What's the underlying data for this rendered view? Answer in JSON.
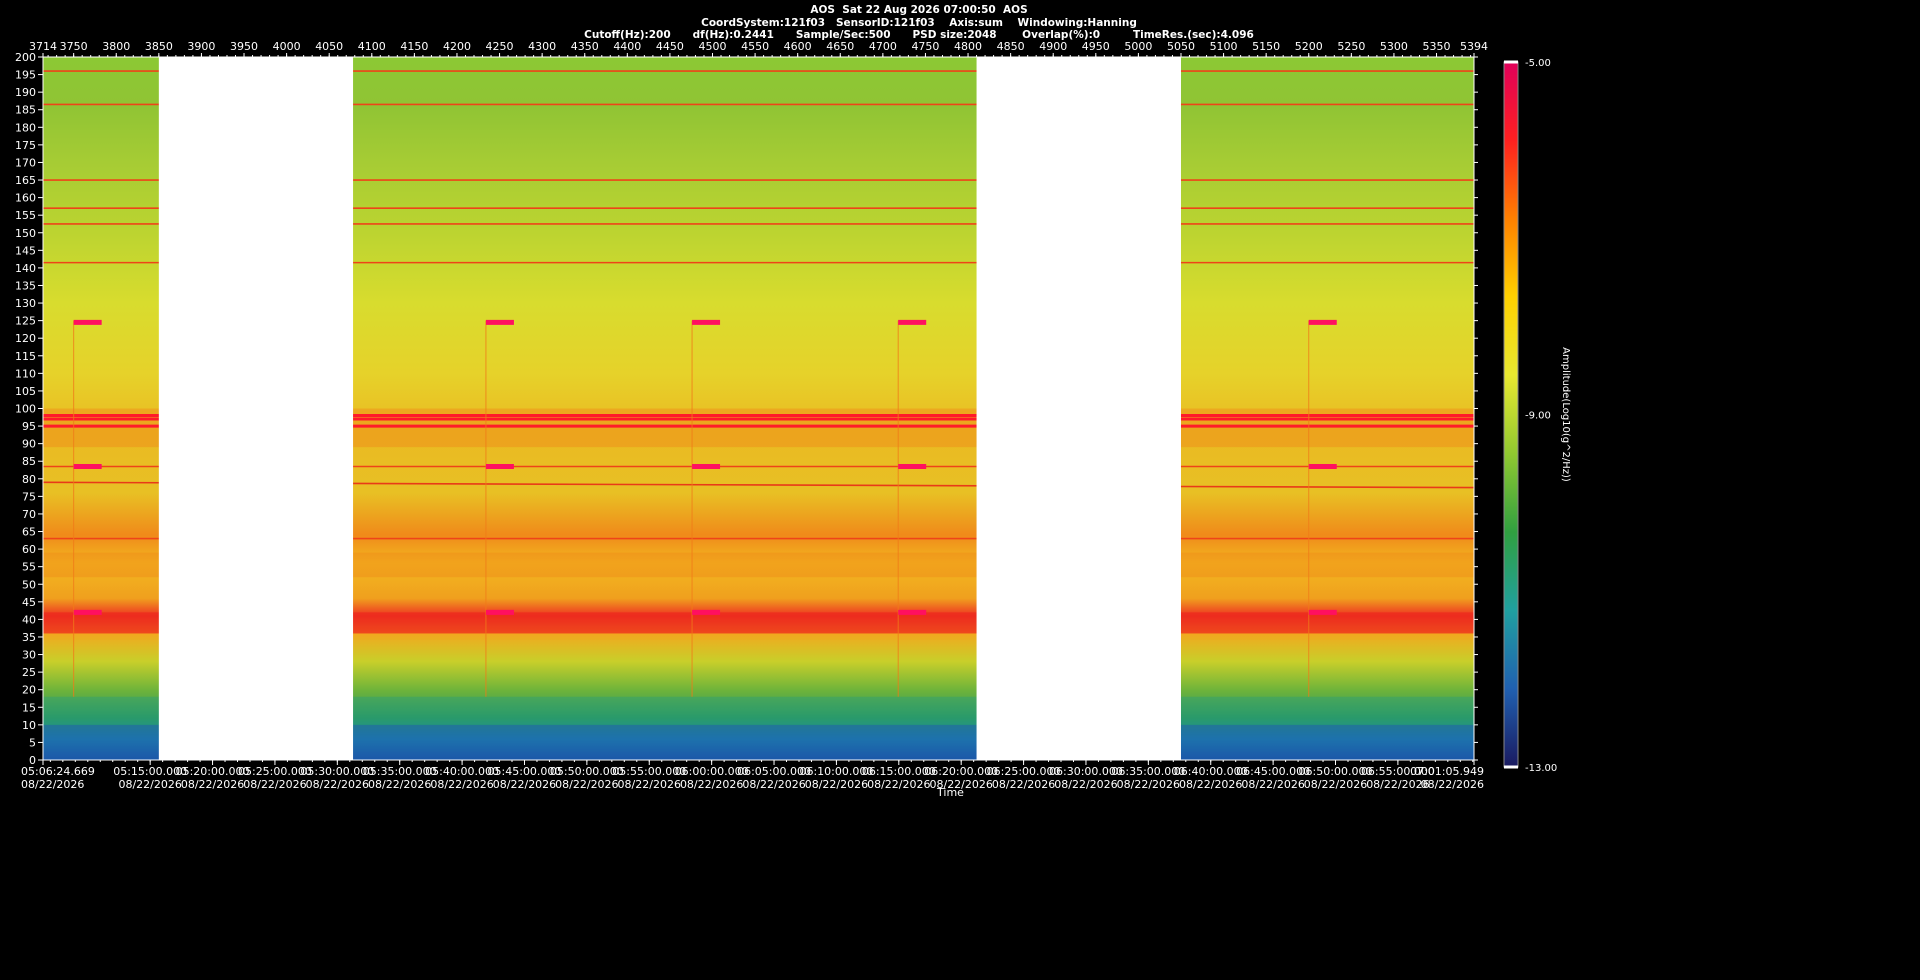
{
  "header": {
    "line1": "AOS  Sat 22 Aug 2026 07:00:50  AOS",
    "line2": "CoordSystem:121f03   SensorID:121f03    Axis:sum    Windowing:Hanning",
    "line3": "Cutoff(Hz):200      df(Hz):0.2441      Sample/Sec:500      PSD size:2048       Overlap(%):0         TimeRes.(sec):4.096"
  },
  "chart_data": {
    "type": "heatmap",
    "title": "AOS  Sat 22 Aug 2026 07:00:50  AOS",
    "xlabel": "Time",
    "ylabel": "",
    "ylim": [
      0,
      200
    ],
    "y_ticks": [
      0,
      5,
      10,
      15,
      20,
      25,
      30,
      35,
      40,
      45,
      50,
      55,
      60,
      65,
      70,
      75,
      80,
      85,
      90,
      95,
      100,
      105,
      110,
      115,
      120,
      125,
      130,
      135,
      140,
      145,
      150,
      155,
      160,
      165,
      170,
      175,
      180,
      185,
      190,
      195,
      200
    ],
    "top_axis": {
      "range": [
        3714,
        5394
      ],
      "ticks": [
        "3714",
        "3750",
        "3800",
        "3850",
        "3900",
        "3950",
        "4000",
        "4050",
        "4100",
        "4150",
        "4200",
        "4250",
        "4300",
        "4350",
        "4400",
        "4450",
        "4500",
        "4550",
        "4600",
        "4650",
        "4700",
        "4750",
        "4800",
        "4850",
        "4900",
        "4950",
        "5000",
        "5050",
        "5100",
        "5150",
        "5200",
        "5250",
        "5300",
        "5350",
        "5394"
      ]
    },
    "time_axis": {
      "start_time": "05:06:24.669",
      "end_time": "07:01:05.949",
      "date": "08/22/2026",
      "ticks": [
        "05:06:24.669",
        "05:15:00.000",
        "05:20:00.000",
        "05:25:00.000",
        "05:30:00.000",
        "05:35:00.000",
        "05:40:00.000",
        "05:45:00.000",
        "05:50:00.000",
        "05:55:00.000",
        "06:00:00.000",
        "06:05:00.000",
        "06:10:00.000",
        "06:15:00.000",
        "06:20:00.000",
        "06:25:00.000",
        "06:30:00.000",
        "06:35:00.000",
        "06:40:00.000",
        "06:45:00.000",
        "06:50:00.000",
        "06:55:00.000",
        "07:01:05.949"
      ]
    },
    "gaps": [
      [
        3850,
        4078
      ],
      [
        4810,
        5050
      ]
    ],
    "colorbar": {
      "label": "Amplitude(Log10(g^2/Hz))",
      "min": -13.0,
      "max": -5.0,
      "tick_labels": [
        "-5.00",
        "-9.00",
        "-13.00"
      ],
      "colors": [
        "#e0005a",
        "#ff2020",
        "#ff8000",
        "#ffd000",
        "#e8e830",
        "#90c830",
        "#30a040",
        "#20a0a0",
        "#2060b0",
        "#1a1a60"
      ]
    },
    "persistent_lines_hz": [
      196,
      186.5,
      165,
      157,
      152.5,
      141.5,
      98,
      97,
      95,
      83.5,
      63
    ],
    "drifting_line_hz": [
      79,
      77.5
    ],
    "broad_bands_hz": [
      [
        36,
        42
      ],
      [
        52,
        59
      ],
      [
        89,
        100
      ]
    ],
    "periodic_markers": {
      "frequencies_hz": [
        124.5,
        83.5,
        42
      ],
      "sample_positions": [
        3750,
        4234,
        4476,
        4718,
        5200
      ]
    }
  }
}
